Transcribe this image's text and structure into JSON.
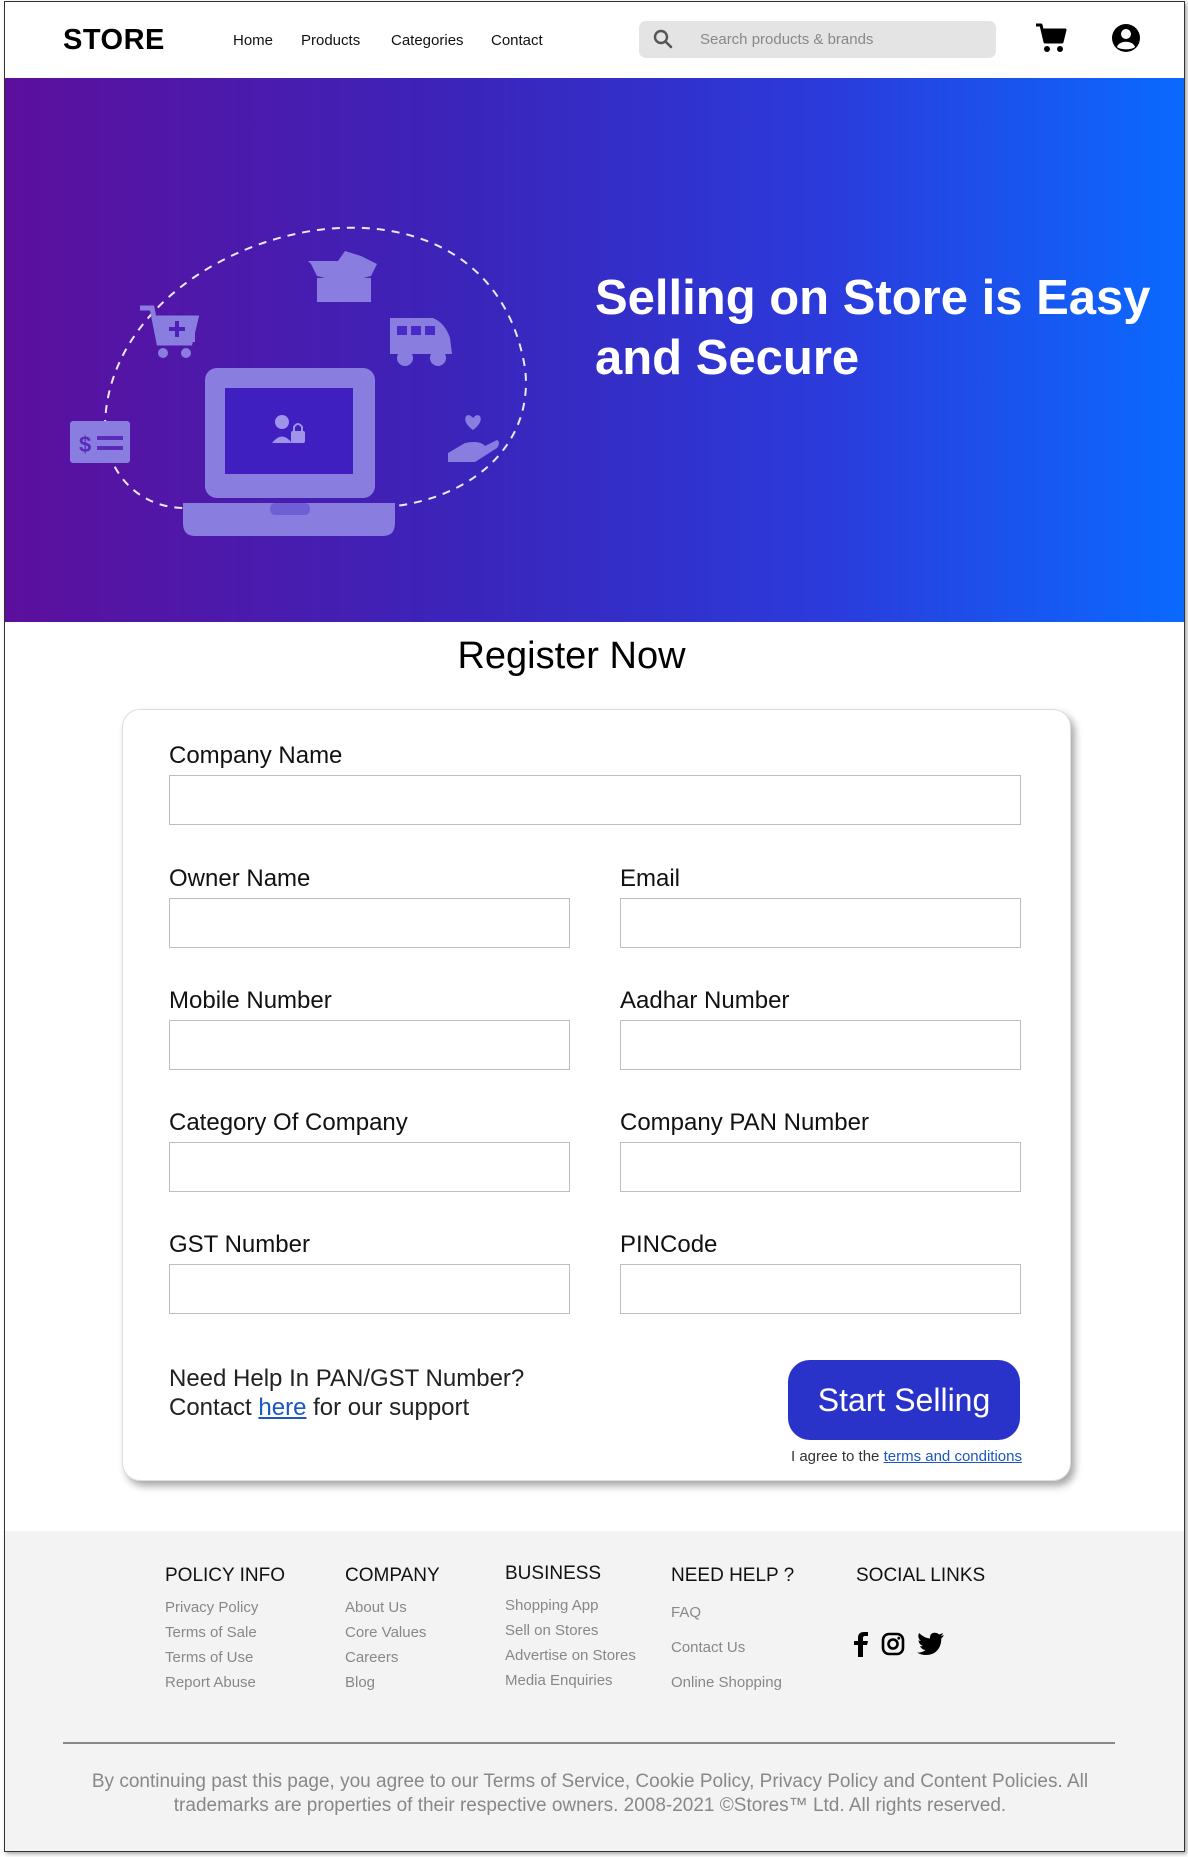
{
  "header": {
    "logo": "STORE",
    "nav": [
      "Home",
      "Products",
      "Categories",
      "Contact"
    ],
    "search_placeholder": "Search products & brands"
  },
  "hero": {
    "title": "Selling on Store is Easy and Secure"
  },
  "register": {
    "title": "Register Now",
    "fields": {
      "company_name": "Company Name",
      "owner_name": "Owner Name",
      "email": "Email",
      "mobile": "Mobile Number",
      "aadhar": "Aadhar Number",
      "category": "Category Of Company",
      "pan": "Company PAN Number",
      "gst": "GST Number",
      "pincode": "PINCode"
    },
    "help_line1": "Need Help In PAN/GST Number?",
    "help_prefix": "Contact ",
    "help_link": "here",
    "help_suffix": " for our support",
    "button": "Start Selling",
    "agree_prefix": "I agree to the ",
    "agree_link": "terms and conditions"
  },
  "footer": {
    "policy": {
      "title": "POLICY INFO",
      "links": [
        "Privacy Policy",
        "Terms of Sale",
        "Terms of Use",
        "Report Abuse"
      ]
    },
    "company": {
      "title": "COMPANY",
      "links": [
        "About Us",
        "Core Values",
        "Careers",
        "Blog"
      ]
    },
    "business": {
      "title": "BUSINESS",
      "links": [
        "Shopping App",
        "Sell on Stores",
        "Advertise on Stores",
        "Media Enquiries"
      ]
    },
    "help": {
      "title": "NEED HELP ?",
      "links": [
        "FAQ",
        "Contact Us",
        "Online Shopping"
      ]
    },
    "social": {
      "title": "SOCIAL LINKS",
      "icons": [
        "facebook-icon",
        "instagram-icon",
        "twitter-icon"
      ]
    },
    "legal": "By continuing past this page, you agree to our Terms of Service, Cookie Policy, Privacy Policy and Content Policies. All trademarks are properties of their respective owners. 2008-2021 ©Stores™ Ltd. All rights reserved."
  },
  "colors": {
    "accent": "#2a33c9",
    "hero_start": "#5c0f9d",
    "hero_end": "#0a6aff",
    "link": "#1a56c4"
  }
}
